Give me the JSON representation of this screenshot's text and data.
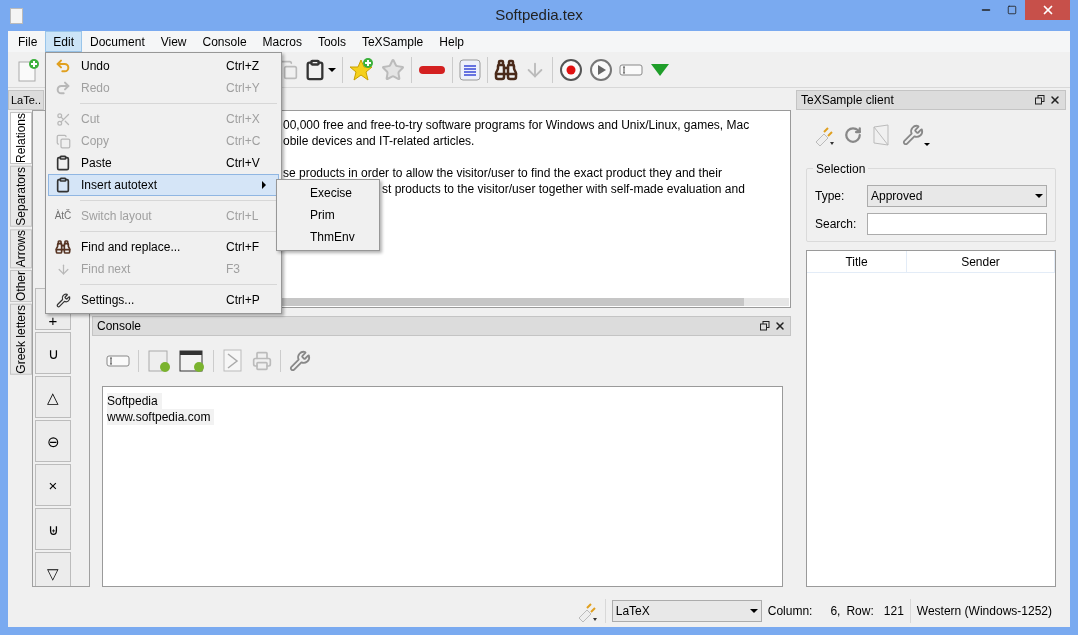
{
  "window": {
    "title": "Softpedia.tex"
  },
  "menu_bar": [
    {
      "label": "File",
      "selected": false
    },
    {
      "label": "Edit",
      "selected": true
    },
    {
      "label": "Document",
      "selected": false
    },
    {
      "label": "View",
      "selected": false
    },
    {
      "label": "Console",
      "selected": false
    },
    {
      "label": "Macros",
      "selected": false
    },
    {
      "label": "Tools",
      "selected": false
    },
    {
      "label": "TeXSample",
      "selected": false
    },
    {
      "label": "Help",
      "selected": false
    }
  ],
  "edit_menu": [
    {
      "kind": "item",
      "label": "Undo",
      "shortcut": "Ctrl+Z",
      "disabled": false,
      "highlighted": false
    },
    {
      "kind": "item",
      "label": "Redo",
      "shortcut": "Ctrl+Y",
      "disabled": true,
      "highlighted": false
    },
    {
      "kind": "separator"
    },
    {
      "kind": "item",
      "label": "Cut",
      "shortcut": "Ctrl+X",
      "disabled": true,
      "highlighted": false
    },
    {
      "kind": "item",
      "label": "Copy",
      "shortcut": "Ctrl+C",
      "disabled": true,
      "highlighted": false
    },
    {
      "kind": "item",
      "label": "Paste",
      "shortcut": "Ctrl+V",
      "disabled": false,
      "highlighted": false
    },
    {
      "kind": "submenu",
      "label": "Insert autotext",
      "disabled": false,
      "highlighted": true
    },
    {
      "kind": "separator"
    },
    {
      "kind": "item",
      "icon_text": "ÀtČ",
      "label": "Switch layout",
      "shortcut": "Ctrl+L",
      "disabled": true,
      "highlighted": false
    },
    {
      "kind": "separator"
    },
    {
      "kind": "item",
      "label": "Find and replace...",
      "shortcut": "Ctrl+F",
      "disabled": false,
      "highlighted": false
    },
    {
      "kind": "item",
      "label": "Find next",
      "shortcut": "F3",
      "disabled": true,
      "highlighted": false
    },
    {
      "kind": "separator"
    },
    {
      "kind": "item",
      "label": "Settings...",
      "shortcut": "Ctrl+P",
      "disabled": false,
      "highlighted": false
    }
  ],
  "autotext_submenu": [
    "Execise",
    "Prim",
    "ThmEnv"
  ],
  "left_dock": {
    "title": "LaTe..",
    "tabs": [
      {
        "label": "Relations",
        "selected": true
      },
      {
        "label": "Separators",
        "selected": false
      },
      {
        "label": "Arrows",
        "selected": false
      },
      {
        "label": "Other",
        "selected": false
      },
      {
        "label": "Greek letters",
        "selected": false
      }
    ],
    "symbols": [
      "+",
      "∪",
      "△",
      "⊖",
      "×",
      "⊎",
      "▽"
    ]
  },
  "editor": {
    "paragraphs": [
      [
        "00,000 free and free-to-try software programs for Windows and Unix/Linux, games, Mac",
        "obile devices and IT-related articles."
      ],
      [
        "se products in order to allow the visitor/user to find the exact product they and their",
        "st products to the visitor/user together with self-made evaluation and"
      ]
    ]
  },
  "console": {
    "title": "Console",
    "lines": [
      "Softpedia",
      "www.softpedia.com"
    ]
  },
  "texsample": {
    "title": "TeXSample client",
    "group": "Selection",
    "type_label": "Type:",
    "type_value": "Approved",
    "search_label": "Search:",
    "columns": [
      "Title",
      "Sender"
    ]
  },
  "status_bar": {
    "mode": "LaTeX",
    "column_label": "Column:",
    "column_value": "6,",
    "row_label": "Row:",
    "row_value": "121",
    "encoding": "Western (Windows-1252)"
  }
}
